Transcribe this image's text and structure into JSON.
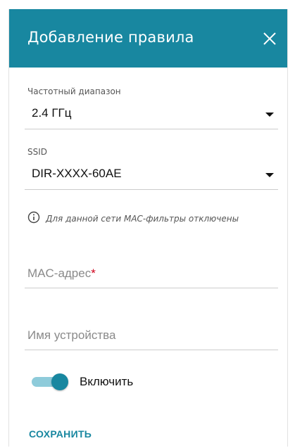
{
  "dialog": {
    "title": "Добавление правила",
    "header_color": "#1887a0",
    "close_icon": "close-icon"
  },
  "frequency": {
    "label": "Частотный диапазон",
    "value": "2.4 ГГц"
  },
  "ssid": {
    "label": "SSID",
    "value": "DIR-XXXX-60AE"
  },
  "info": {
    "icon": "info-icon",
    "text": "Для данной сети MAC-фильтры отключены"
  },
  "mac": {
    "placeholder": "MAC-адрес",
    "required_mark": "*"
  },
  "device_name": {
    "placeholder": "Имя устройства"
  },
  "enable": {
    "label": "Включить",
    "checked": true
  },
  "actions": {
    "save_label": "СОХРАНИТЬ"
  }
}
